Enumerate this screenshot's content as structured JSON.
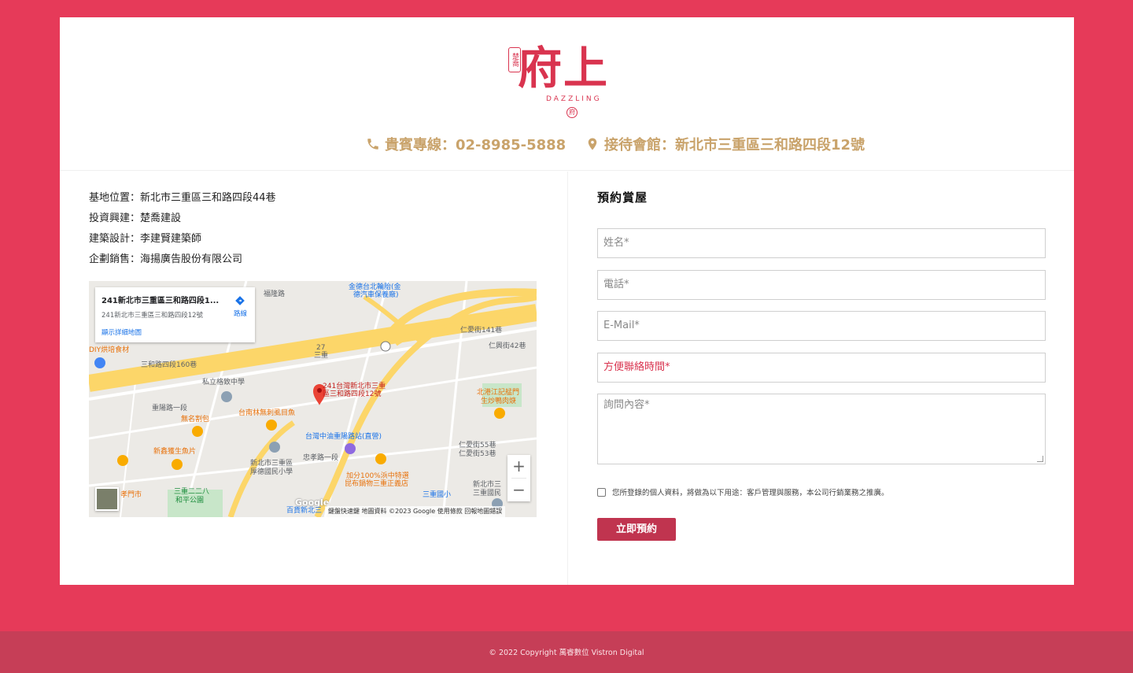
{
  "logo": {
    "seal_text": "楚喬",
    "brand_text": "府上",
    "sub_text": "DAZZLING",
    "emblem": "府"
  },
  "contact": {
    "phone_label": "貴賓專線：02-8985-5888",
    "address_label": "接待會館：新北市三重區三和路四段12號",
    "phone_icon": "phone-icon",
    "location_icon": "map-pin-icon"
  },
  "info": {
    "lines": [
      "基地位置：新北市三重區三和路四段44巷",
      "投資興建：楚喬建設",
      "建築設計：李建賢建築師",
      "企劃銷售：海揚廣告股份有限公司"
    ]
  },
  "map": {
    "infobox_title": "241新北市三重區三和路四段1...",
    "infobox_address": "241新北市三重區三和路四段12號",
    "infobox_link": "顯示詳細地圖",
    "directions_label": "路線",
    "marker_label_1": "241台灣新北市三重",
    "marker_label_2": "區三和路四段12號",
    "zoom_in": "+",
    "zoom_out": "−",
    "footer": "鍵盤快速鍵    地圖資料 ©2023 Google    使用條款    回報地圖錯誤",
    "google_logo": "Google",
    "places": [
      {
        "name": "金德台北輪胎(金",
        "cls": "lbl-blue"
      },
      {
        "name": "德汽車保養廠)",
        "cls": "lbl-blue"
      },
      {
        "name": "私立格致中學",
        "cls": "lbl-gray"
      },
      {
        "name": "台南林無刺虱目魚",
        "cls": "lbl-orange"
      },
      {
        "name": "無名割包",
        "cls": "lbl-orange"
      },
      {
        "name": "新鑫獲生魚片",
        "cls": "lbl-orange"
      },
      {
        "name": "台灣中油重陽路站(直營)",
        "cls": "lbl-blue"
      },
      {
        "name": "新北市三重區",
        "cls": "lbl-gray"
      },
      {
        "name": "厚德國民小學",
        "cls": "lbl-gray"
      },
      {
        "name": "加分100%浜中特選",
        "cls": "lbl-orange"
      },
      {
        "name": "昆布鍋物三重正義店",
        "cls": "lbl-orange"
      },
      {
        "name": "北港江記艋門",
        "cls": "lbl-orange"
      },
      {
        "name": "生炒鴨肉焿",
        "cls": "lbl-orange"
      },
      {
        "name": "三重二二八",
        "cls": "lbl-teal"
      },
      {
        "name": "和平公園",
        "cls": "lbl-teal"
      },
      {
        "name": "三重國小",
        "cls": "lbl-blue"
      },
      {
        "name": "新北市三",
        "cls": "lbl-gray"
      },
      {
        "name": "三重國民",
        "cls": "lbl-gray"
      },
      {
        "name": "DIY烘培食材",
        "cls": "lbl-orange"
      },
      {
        "name": "孝門市",
        "cls": "lbl-orange"
      },
      {
        "name": "百貨新北三",
        "cls": "lbl-blue"
      },
      {
        "name": "三和路四段160巷",
        "cls": "lbl-gray"
      },
      {
        "name": "忠孝路一段",
        "cls": "lbl-gray"
      },
      {
        "name": "重陽路一段",
        "cls": "lbl-gray"
      },
      {
        "name": "仁愛街141巷",
        "cls": "lbl-gray"
      },
      {
        "name": "仁愛街55巷",
        "cls": "lbl-gray"
      },
      {
        "name": "仁愛街53巷",
        "cls": "lbl-gray"
      },
      {
        "name": "仁興街42巷",
        "cls": "lbl-gray"
      },
      {
        "name": "福隆路",
        "cls": "lbl-gray"
      },
      {
        "name": "三重",
        "cls": "lbl-gray"
      },
      {
        "name": "27",
        "cls": "lbl-gray"
      }
    ]
  },
  "form": {
    "title": "預約賞屋",
    "name_placeholder": "姓名*",
    "phone_placeholder": "電話*",
    "email_placeholder": "E-Mail*",
    "time_placeholder": "方便聯絡時間*",
    "message_placeholder": "詢問內容*",
    "consent_text": "您所登錄的個人資料，將做為以下用途：客戶管理與服務，本公司行銷業務之推廣。",
    "submit_label": "立即預約"
  },
  "footer": {
    "copyright": "© 2022 Copyright 萬睿數位 Vistron Digital"
  },
  "colors": {
    "background": "#e63a59",
    "brand": "#d9344f",
    "gold": "#c9a36b",
    "button": "#c0344f",
    "footer": "#c63e57"
  }
}
